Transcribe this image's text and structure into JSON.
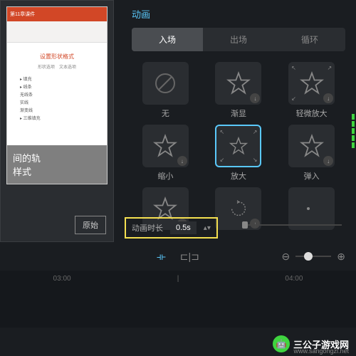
{
  "panel_title": "动画",
  "tabs": {
    "enter": "入场",
    "exit": "出场",
    "loop": "循环"
  },
  "animations": {
    "none": "无",
    "fade": "渐显",
    "slight_zoom": "轻微放大",
    "shrink": "缩小",
    "zoom": "放大",
    "bounce": "弹入"
  },
  "duration": {
    "label": "动画时长",
    "value": "0.5s"
  },
  "preview": {
    "ribbon_title": "第11章课件",
    "sidebar_title": "设置形状格式",
    "options": [
      "形状选项",
      "文本选项"
    ],
    "list": [
      "▸ 填充",
      "▸ 线条",
      "无线条",
      "实线",
      "渐变线",
      "▸ 三维填充"
    ],
    "overlay_line1": "间的轨",
    "overlay_line2": "样式"
  },
  "original_btn": "原始",
  "timeline": {
    "t1": "03:00",
    "t2": "04:00"
  },
  "watermark": {
    "text": "三公子游戏网",
    "url": "www.sangongzi.net"
  }
}
